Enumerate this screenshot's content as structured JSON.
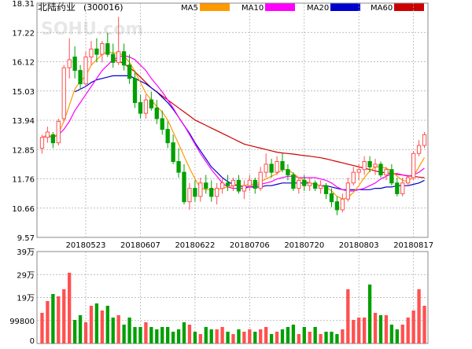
{
  "header": {
    "stock_name": "北陆药业",
    "stock_code": "(300016)",
    "watermark": "SOHU.com"
  },
  "legend": [
    {
      "label": "MA5",
      "color": "#ff9900"
    },
    {
      "label": "MA10",
      "color": "#ff00ff"
    },
    {
      "label": "MA20",
      "color": "#0000cc"
    },
    {
      "label": "MA60",
      "color": "#cc0000"
    }
  ],
  "colors": {
    "up": "#ff5050",
    "down": "#00a000",
    "grid": "#aaaaaa",
    "frame": "#888888"
  },
  "chart_data": [
    {
      "type": "candlestick",
      "title": "北陆药业 (300016)",
      "y_ticks": [
        "18.31",
        "17.22",
        "16.12",
        "15.03",
        "13.94",
        "12.85",
        "11.76",
        "10.66",
        "9.57"
      ],
      "ylim": [
        9.57,
        18.31
      ],
      "x_ticks": [
        "20180523",
        "20180607",
        "20180622",
        "20180706",
        "20180720",
        "20180803",
        "20180817"
      ],
      "x_tick_index": [
        8,
        18,
        28,
        38,
        48,
        58,
        68
      ],
      "grid": true,
      "ohlc": [
        [
          12.9,
          13.4,
          12.7,
          13.3
        ],
        [
          13.3,
          13.7,
          13.1,
          13.5
        ],
        [
          13.4,
          13.5,
          12.9,
          13.1
        ],
        [
          13.1,
          14.0,
          13.0,
          13.9
        ],
        [
          14.0,
          16.0,
          13.9,
          15.9
        ],
        [
          15.9,
          17.0,
          15.5,
          16.2
        ],
        [
          16.3,
          16.7,
          15.5,
          15.8
        ],
        [
          15.8,
          16.0,
          15.1,
          15.3
        ],
        [
          15.3,
          16.5,
          15.2,
          16.3
        ],
        [
          16.3,
          16.9,
          16.0,
          16.6
        ],
        [
          16.6,
          17.0,
          16.1,
          16.4
        ],
        [
          16.4,
          16.9,
          16.1,
          16.8
        ],
        [
          16.8,
          17.2,
          16.3,
          16.4
        ],
        [
          16.4,
          16.8,
          15.9,
          16.1
        ],
        [
          16.1,
          17.8,
          16.0,
          16.5
        ],
        [
          16.5,
          16.8,
          15.8,
          16.0
        ],
        [
          16.0,
          16.4,
          15.3,
          15.5
        ],
        [
          15.5,
          15.8,
          14.4,
          14.6
        ],
        [
          14.6,
          14.9,
          14.0,
          14.2
        ],
        [
          14.2,
          14.9,
          14.0,
          14.7
        ],
        [
          14.7,
          15.0,
          14.3,
          14.4
        ],
        [
          14.4,
          14.7,
          13.8,
          14.0
        ],
        [
          14.0,
          14.3,
          13.4,
          13.6
        ],
        [
          13.6,
          13.9,
          12.9,
          13.1
        ],
        [
          13.1,
          13.4,
          12.3,
          12.4
        ],
        [
          12.4,
          12.9,
          11.8,
          12.0
        ],
        [
          12.0,
          12.3,
          10.8,
          10.9
        ],
        [
          10.9,
          11.6,
          10.6,
          11.4
        ],
        [
          11.4,
          11.7,
          10.9,
          11.1
        ],
        [
          11.1,
          11.8,
          10.9,
          11.6
        ],
        [
          11.6,
          11.9,
          11.2,
          11.4
        ],
        [
          11.4,
          11.7,
          10.9,
          11.1
        ],
        [
          11.1,
          11.6,
          10.8,
          11.4
        ],
        [
          11.4,
          11.8,
          11.2,
          11.6
        ],
        [
          11.6,
          11.9,
          11.3,
          11.5
        ],
        [
          11.5,
          11.8,
          11.3,
          11.7
        ],
        [
          11.7,
          11.9,
          11.2,
          11.3
        ],
        [
          11.3,
          11.7,
          11.0,
          11.5
        ],
        [
          11.5,
          11.9,
          11.3,
          11.7
        ],
        [
          11.7,
          11.8,
          11.2,
          11.4
        ],
        [
          11.4,
          12.2,
          11.3,
          12.0
        ],
        [
          12.0,
          12.7,
          11.8,
          12.3
        ],
        [
          12.3,
          12.5,
          11.8,
          12.0
        ],
        [
          12.0,
          12.6,
          11.9,
          12.4
        ],
        [
          12.4,
          12.7,
          12.0,
          12.1
        ],
        [
          12.1,
          12.3,
          11.7,
          11.9
        ],
        [
          11.9,
          12.0,
          11.3,
          11.4
        ],
        [
          11.4,
          11.8,
          11.2,
          11.7
        ],
        [
          11.7,
          11.9,
          11.3,
          11.5
        ],
        [
          11.5,
          11.8,
          11.3,
          11.6
        ],
        [
          11.6,
          11.7,
          11.3,
          11.4
        ],
        [
          11.4,
          11.7,
          11.2,
          11.5
        ],
        [
          11.5,
          11.6,
          11.0,
          11.2
        ],
        [
          11.2,
          11.4,
          10.7,
          10.9
        ],
        [
          10.9,
          11.1,
          10.4,
          10.6
        ],
        [
          10.6,
          11.2,
          10.5,
          11.0
        ],
        [
          11.0,
          11.8,
          10.9,
          11.6
        ],
        [
          11.6,
          12.2,
          11.5,
          12.0
        ],
        [
          12.0,
          12.3,
          11.7,
          12.1
        ],
        [
          12.1,
          12.6,
          11.9,
          12.4
        ],
        [
          12.4,
          12.6,
          12.0,
          12.2
        ],
        [
          12.2,
          12.5,
          11.9,
          12.3
        ],
        [
          12.3,
          12.4,
          11.8,
          11.9
        ],
        [
          11.9,
          12.2,
          11.7,
          12.1
        ],
        [
          12.1,
          12.3,
          11.5,
          11.6
        ],
        [
          11.6,
          11.8,
          11.1,
          11.2
        ],
        [
          11.2,
          11.8,
          11.1,
          11.6
        ],
        [
          11.6,
          11.9,
          11.5,
          11.8
        ],
        [
          11.8,
          12.8,
          11.7,
          12.7
        ],
        [
          12.7,
          13.2,
          12.6,
          13.0
        ],
        [
          13.0,
          13.5,
          12.9,
          13.4
        ]
      ],
      "ma5": [
        13.3,
        13.4,
        13.3,
        13.45,
        13.9,
        14.5,
        15.1,
        15.4,
        15.6,
        16.0,
        16.2,
        16.4,
        16.5,
        16.45,
        16.45,
        16.35,
        16.1,
        15.75,
        15.35,
        14.95,
        14.7,
        14.45,
        14.25,
        13.95,
        13.5,
        13.05,
        12.6,
        12.15,
        11.75,
        11.4,
        11.35,
        11.35,
        11.35,
        11.4,
        11.45,
        11.5,
        11.5,
        11.5,
        11.55,
        11.55,
        11.65,
        11.75,
        11.85,
        11.95,
        12.1,
        12.1,
        11.95,
        11.8,
        11.7,
        11.6,
        11.55,
        11.5,
        11.45,
        11.3,
        11.1,
        11.0,
        11.05,
        11.25,
        11.5,
        11.8,
        12.05,
        12.2,
        12.2,
        12.15,
        12.05,
        11.85,
        11.7,
        11.65,
        11.85,
        12.2,
        12.55
      ],
      "ma10": [
        13.3,
        13.35,
        13.3,
        13.4,
        13.6,
        13.9,
        14.3,
        14.6,
        14.9,
        15.2,
        15.5,
        15.8,
        16.0,
        16.2,
        16.3,
        16.35,
        16.3,
        16.2,
        16.0,
        15.8,
        15.5,
        15.25,
        15.0,
        14.7,
        14.4,
        14.05,
        13.75,
        13.4,
        13.05,
        12.7,
        12.4,
        12.1,
        11.85,
        11.6,
        11.45,
        11.4,
        11.4,
        11.4,
        11.45,
        11.5,
        11.55,
        11.6,
        11.65,
        11.75,
        11.8,
        11.85,
        11.85,
        11.8,
        11.8,
        11.8,
        11.8,
        11.75,
        11.7,
        11.6,
        11.45,
        11.35,
        11.3,
        11.3,
        11.35,
        11.4,
        11.5,
        11.6,
        11.75,
        11.85,
        11.95,
        11.95,
        11.9,
        11.85,
        11.9,
        12.0,
        12.15
      ],
      "ma20": [
        null,
        null,
        null,
        null,
        null,
        null,
        15.0,
        15.1,
        15.2,
        15.35,
        15.45,
        15.5,
        15.55,
        15.6,
        15.6,
        15.6,
        15.6,
        15.5,
        15.4,
        15.3,
        15.15,
        15.0,
        14.8,
        14.6,
        14.35,
        14.05,
        13.75,
        13.45,
        13.1,
        12.8,
        12.5,
        12.2,
        12.0,
        11.8,
        11.65,
        11.55,
        11.5,
        11.45,
        11.45,
        11.45,
        11.45,
        11.5,
        11.5,
        11.55,
        11.6,
        11.6,
        11.6,
        11.6,
        11.6,
        11.6,
        11.55,
        11.5,
        11.5,
        11.45,
        11.4,
        11.35,
        11.35,
        11.35,
        11.35,
        11.35,
        11.35,
        11.4,
        11.4,
        11.45,
        11.45,
        11.5,
        11.5,
        11.5,
        11.55,
        11.6,
        11.7
      ],
      "ma60": [
        null,
        null,
        null,
        null,
        null,
        null,
        null,
        null,
        null,
        null,
        null,
        null,
        null,
        16.2,
        16.15,
        16.05,
        15.9,
        15.75,
        15.55,
        15.35,
        15.15,
        15.0,
        14.85,
        14.7,
        14.55,
        14.4,
        14.25,
        14.1,
        13.95,
        13.85,
        13.75,
        13.65,
        13.55,
        13.45,
        13.35,
        13.25,
        13.15,
        13.05,
        13.0,
        12.95,
        12.9,
        12.85,
        12.8,
        12.75,
        12.72,
        12.7,
        12.68,
        12.65,
        12.62,
        12.6,
        12.57,
        12.54,
        12.5,
        12.45,
        12.4,
        12.35,
        12.3,
        12.25,
        12.2,
        12.15,
        12.1,
        12.05,
        12.0,
        11.98,
        11.95,
        11.92,
        11.9,
        11.87,
        11.85,
        11.82,
        11.8
      ]
    },
    {
      "type": "bar",
      "title": "",
      "y_ticks": [
        "39万",
        "29万",
        "19万",
        "99800",
        "0"
      ],
      "ylim": [
        0,
        390000
      ],
      "volume": [
        130000,
        180000,
        210000,
        200000,
        230000,
        300000,
        100000,
        120000,
        90000,
        160000,
        170000,
        140000,
        160000,
        110000,
        120000,
        80000,
        110000,
        70000,
        70000,
        90000,
        70000,
        60000,
        70000,
        70000,
        50000,
        60000,
        90000,
        80000,
        50000,
        40000,
        70000,
        60000,
        60000,
        70000,
        50000,
        40000,
        60000,
        50000,
        60000,
        50000,
        60000,
        70000,
        40000,
        50000,
        60000,
        70000,
        80000,
        40000,
        70000,
        50000,
        70000,
        40000,
        50000,
        50000,
        40000,
        60000,
        230000,
        100000,
        110000,
        110000,
        250000,
        130000,
        120000,
        120000,
        80000,
        60000,
        80000,
        110000,
        140000,
        230000,
        160000
      ]
    }
  ]
}
